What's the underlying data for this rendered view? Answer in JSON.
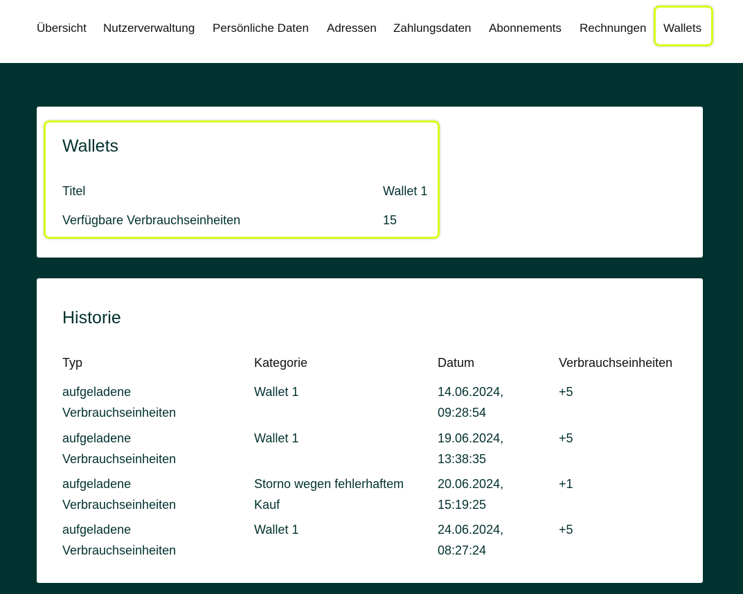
{
  "nav": {
    "items": [
      {
        "label": "Übersicht"
      },
      {
        "label": "Nutzerverwaltung"
      },
      {
        "label": "Persönliche Daten"
      },
      {
        "label": "Adressen"
      },
      {
        "label": "Zahlungsdaten"
      },
      {
        "label": "Abonnements"
      },
      {
        "label": "Rechnungen"
      },
      {
        "label": "Wallets"
      }
    ],
    "active": "Wallets"
  },
  "wallet": {
    "title": "Wallets",
    "fields": [
      {
        "label": "Titel",
        "value": "Wallet 1"
      },
      {
        "label": "Verfügbare Verbrauchseinheiten",
        "value": "15"
      }
    ]
  },
  "history": {
    "title": "Historie",
    "columns": [
      "Typ",
      "Kategorie",
      "Datum",
      "Verbrauchseinheiten"
    ],
    "rows": [
      {
        "typ": [
          "aufgeladene",
          "Verbrauchseinheiten"
        ],
        "kategorie": [
          "Wallet 1",
          ""
        ],
        "datum": [
          "14.06.2024,",
          "09:28:54"
        ],
        "einheiten": "+5"
      },
      {
        "typ": [
          "aufgeladene",
          "Verbrauchseinheiten"
        ],
        "kategorie": [
          "Wallet 1",
          ""
        ],
        "datum": [
          "19.06.2024,",
          "13:38:35"
        ],
        "einheiten": "+5"
      },
      {
        "typ": [
          "aufgeladene",
          "Verbrauchseinheiten"
        ],
        "kategorie": [
          "Storno wegen fehlerhaftem",
          "Kauf"
        ],
        "datum": [
          "20.06.2024,",
          "15:19:25"
        ],
        "einheiten": "+1"
      },
      {
        "typ": [
          "aufgeladene",
          "Verbrauchseinheiten"
        ],
        "kategorie": [
          "Wallet 1",
          ""
        ],
        "datum": [
          "24.06.2024,",
          "08:27:24"
        ],
        "einheiten": "+5"
      }
    ]
  },
  "colors": {
    "background": "#003330",
    "highlight": "#d7fb1a",
    "text": "#00302d"
  }
}
